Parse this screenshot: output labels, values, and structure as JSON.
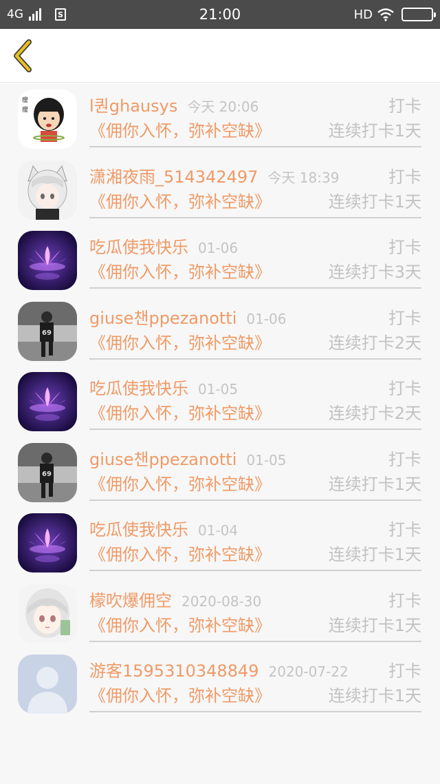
{
  "status_bar": {
    "network": "4G",
    "sim_label": "S",
    "time": "21:00",
    "hd_label": "HD"
  },
  "colors": {
    "accent": "#ef9a66",
    "muted": "#c2c2c2",
    "back_icon": "#e8c020"
  },
  "nav": {
    "back_icon": "chevron-left-icon"
  },
  "items": [
    {
      "name": "l퀀ghausys",
      "date": "今天 20:06",
      "action": "打卡",
      "book": "《佣你入怀，弥补空缺》",
      "streak": "连续打卡1天",
      "avatar": "cartoon-avatar"
    },
    {
      "name": "潇湘夜雨_514342497",
      "date": "今天 18:39",
      "action": "打卡",
      "book": "《佣你入怀，弥补空缺》",
      "streak": "连续打卡1天",
      "avatar": "anime-catgirl-avatar"
    },
    {
      "name": "吃瓜使我快乐",
      "date": "01-06",
      "action": "打卡",
      "book": "《佣你入怀，弥补空缺》",
      "streak": "连续打卡3天",
      "avatar": "lotus-avatar"
    },
    {
      "name": "giuse챈ppezanotti",
      "date": "01-06",
      "action": "打卡",
      "book": "《佣你入怀，弥补空缺》",
      "streak": "连续打卡2天",
      "avatar": "photo-avatar"
    },
    {
      "name": "吃瓜使我快乐",
      "date": "01-05",
      "action": "打卡",
      "book": "《佣你入怀，弥补空缺》",
      "streak": "连续打卡2天",
      "avatar": "lotus-avatar"
    },
    {
      "name": "giuse챈ppezanotti",
      "date": "01-05",
      "action": "打卡",
      "book": "《佣你入怀，弥补空缺》",
      "streak": "连续打卡1天",
      "avatar": "photo-avatar"
    },
    {
      "name": "吃瓜使我快乐",
      "date": "01-04",
      "action": "打卡",
      "book": "《佣你入怀，弥补空缺》",
      "streak": "连续打卡1天",
      "avatar": "lotus-avatar"
    },
    {
      "name": "檬吹爆佣空",
      "date": "2020-08-30",
      "action": "打卡",
      "book": "《佣你入怀，弥补空缺》",
      "streak": "连续打卡1天",
      "avatar": "anime-girl-avatar"
    },
    {
      "name": "游客1595310348849",
      "date": "2020-07-22",
      "action": "打卡",
      "book": "《佣你入怀，弥补空缺》",
      "streak": "连续打卡1天",
      "avatar": "default-user-avatar"
    }
  ]
}
